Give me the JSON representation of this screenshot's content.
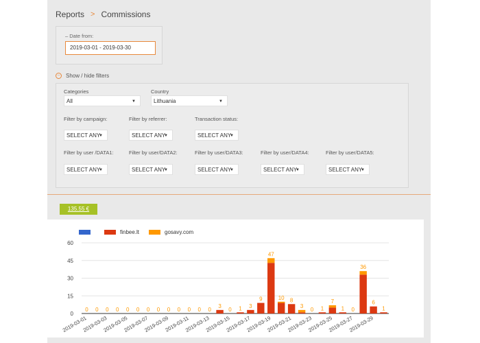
{
  "breadcrumb": {
    "parent": "Reports",
    "current": "Commissions"
  },
  "date": {
    "label": "– Date from:",
    "value": "2019-03-01 - 2019-03-30"
  },
  "filters_toggle": "Show / hide filters",
  "filters": {
    "categories": {
      "label": "Categories",
      "value": "All"
    },
    "country": {
      "label": "Country",
      "value": "Lithuania"
    },
    "campaign": {
      "label": "Filter by campaign:",
      "value": "SELECT ANY"
    },
    "referrer": {
      "label": "Filter by referrer:",
      "value": "SELECT ANY"
    },
    "transaction_status": {
      "label": "Transaction status:",
      "value": "SELECT ANY"
    },
    "data1": {
      "label": "Filter by user /DATA1:",
      "value": "SELECT ANY"
    },
    "data2": {
      "label": "Filter by user/DATA2:",
      "value": "SELECT ANY"
    },
    "data3": {
      "label": "Filter by user/DATA3:",
      "value": "SELECT ANY"
    },
    "data4": {
      "label": "Filter by user/DATA4:",
      "value": "SELECT ANY"
    },
    "data5": {
      "label": "Filter by user/DATA5:",
      "value": "SELECT ANY"
    }
  },
  "total": "135.55 €",
  "colors": {
    "accent": "#e8883a",
    "total_bg": "#a6c126",
    "series_blue": "#3366cc",
    "series_red": "#dc3912",
    "series_orange": "#ff9900"
  },
  "chart_data": {
    "type": "bar",
    "stacked": true,
    "categories": [
      "2019-03-01",
      "2019-03-02",
      "2019-03-03",
      "2019-03-04",
      "2019-03-05",
      "2019-03-06",
      "2019-03-07",
      "2019-03-08",
      "2019-03-09",
      "2019-03-10",
      "2019-03-11",
      "2019-03-12",
      "2019-03-13",
      "2019-03-14",
      "2019-03-15",
      "2019-03-16",
      "2019-03-17",
      "2019-03-18",
      "2019-03-19",
      "2019-03-20",
      "2019-03-21",
      "2019-03-22",
      "2019-03-23",
      "2019-03-24",
      "2019-03-25",
      "2019-03-26",
      "2019-03-27",
      "2019-03-28",
      "2019-03-29",
      "2019-03-30"
    ],
    "tick_labels": [
      "2019-03-01",
      "2019-03-03",
      "2019-03-05",
      "2019-03-07",
      "2019-03-09",
      "2019-03-11",
      "2019-03-13",
      "2019-03-15",
      "2019-03-17",
      "2019-03-19",
      "2019-03-21",
      "2019-03-23",
      "2019-03-25",
      "2019-03-27",
      "2019-03-29"
    ],
    "series": [
      {
        "name": "",
        "color": "#3366cc",
        "values": [
          0,
          0,
          0,
          0,
          0,
          0,
          0,
          0,
          0,
          0,
          0,
          0,
          0,
          0,
          0,
          0,
          0,
          0,
          0,
          0,
          0,
          0,
          0,
          0,
          0,
          0,
          0,
          0,
          0,
          0
        ]
      },
      {
        "name": "finbee.lt",
        "color": "#dc3912",
        "values": [
          0,
          0,
          0,
          0,
          0,
          0,
          0,
          0,
          0,
          0,
          0,
          0,
          0,
          3,
          0,
          1,
          3,
          9,
          43,
          9,
          8,
          1,
          0,
          1,
          5,
          1,
          0,
          33,
          6,
          1
        ]
      },
      {
        "name": "gosavy.com",
        "color": "#ff9900",
        "values": [
          0,
          0,
          0,
          0,
          0,
          0,
          0,
          0,
          0,
          0,
          0,
          0,
          0,
          0,
          0,
          0,
          0,
          0,
          4,
          1,
          0,
          2,
          0,
          0,
          2,
          0,
          0,
          3,
          0,
          0
        ]
      }
    ],
    "totals": [
      "0",
      "0",
      "0",
      "0",
      "0",
      "0",
      "0",
      "0",
      "0",
      "0",
      "0",
      "0",
      "0",
      "3",
      "0",
      "1",
      "3",
      "9",
      "47",
      "10",
      "8",
      "3",
      "0",
      "1",
      "7",
      "1",
      "0",
      "36",
      "6",
      "1"
    ],
    "yticks": [
      0,
      15,
      30,
      45,
      60
    ],
    "ylim": [
      0,
      60
    ],
    "grid": true,
    "legend": "top-left"
  }
}
